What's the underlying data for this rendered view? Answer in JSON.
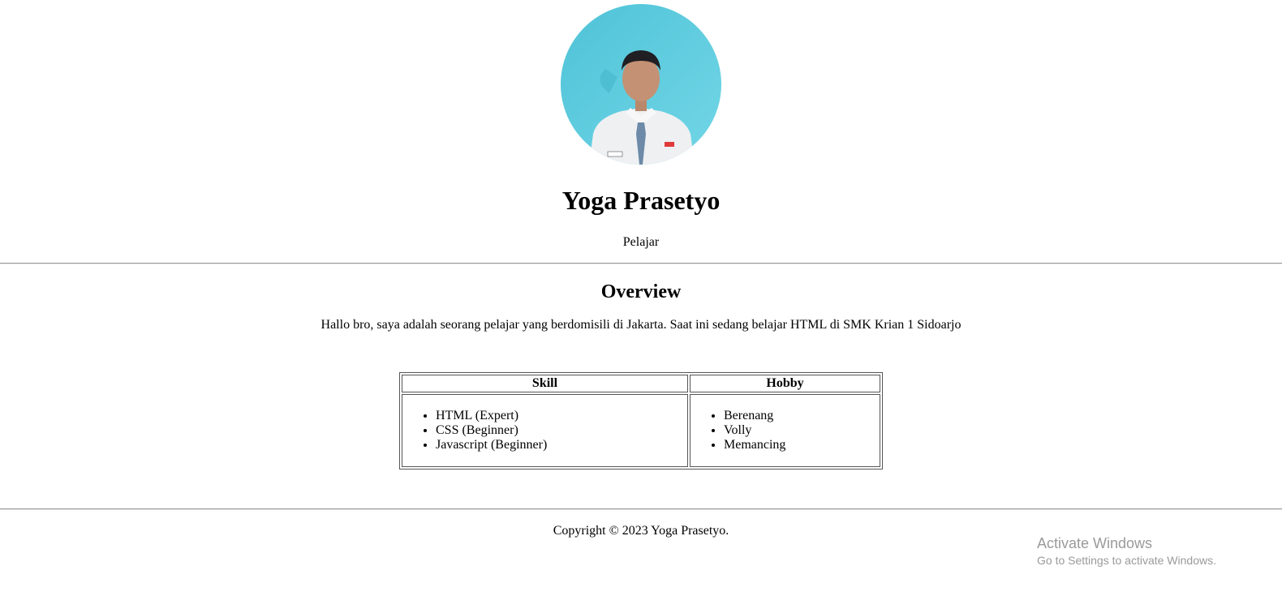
{
  "profile": {
    "name": "Yoga Prasetyo",
    "role": "Pelajar"
  },
  "overview": {
    "title": "Overview",
    "text": "Hallo bro, saya adalah seorang pelajar yang berdomisili di Jakarta. Saat ini sedang belajar HTML di SMK Krian 1 Sidoarjo"
  },
  "table": {
    "headers": [
      "Skill",
      "Hobby"
    ],
    "skills": [
      "HTML (Expert)",
      "CSS (Beginner)",
      "Javascript (Beginner)"
    ],
    "hobbies": [
      "Berenang",
      "Volly",
      "Memancing"
    ]
  },
  "footer": {
    "copyright": "Copyright © 2023 Yoga Prasetyo."
  },
  "watermark": {
    "title": "Activate Windows",
    "subtitle": "Go to Settings to activate Windows."
  },
  "colors": {
    "photo_background": "#5cc8dc",
    "divider": "#9a9a9a",
    "watermark_text": "#9a9a9a"
  }
}
